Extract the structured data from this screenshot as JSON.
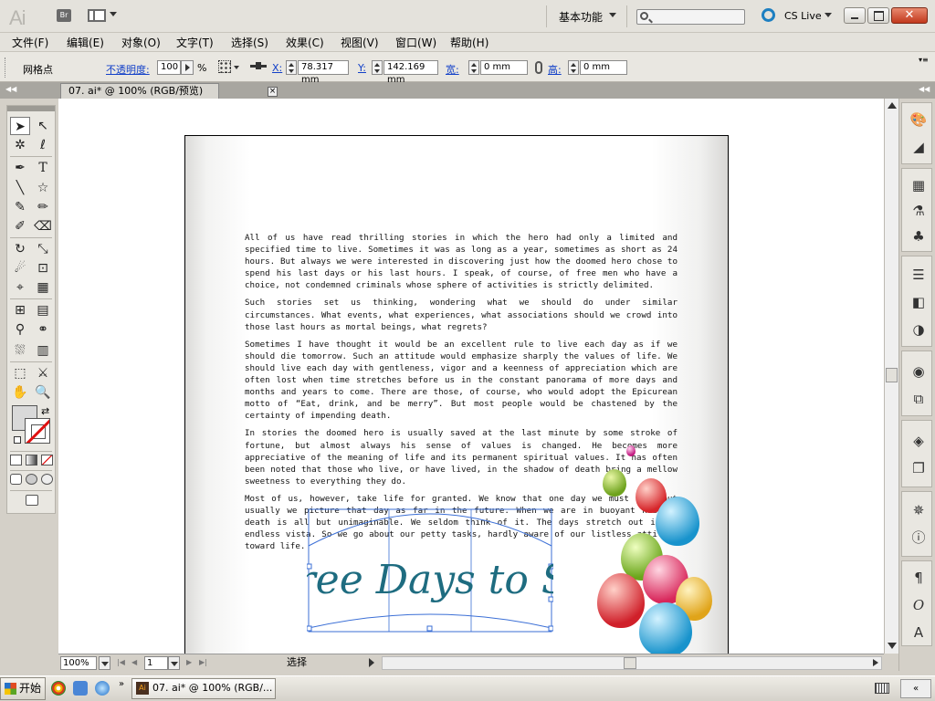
{
  "app": {
    "logo": "Ai",
    "bridge": "Br"
  },
  "titlebar": {
    "workspace": "基本功能",
    "search_placeholder": "",
    "cs_live": "CS Live"
  },
  "menu": [
    "文件(F)",
    "编辑(E)",
    "对象(O)",
    "文字(T)",
    "选择(S)",
    "效果(C)",
    "视图(V)",
    "窗口(W)",
    "帮助(H)"
  ],
  "control": {
    "selection_type": "网格点",
    "opacity_label": "不透明度:",
    "opacity_value": "100",
    "opacity_unit": "%",
    "x_label": "X:",
    "x_value": "78.317 mm",
    "y_label": "Y:",
    "y_value": "142.169 mm",
    "w_label": "宽:",
    "w_value": "0 mm",
    "h_label": "高:",
    "h_value": "0 mm"
  },
  "document": {
    "tab_title": "07. ai* @ 100% (RGB/预览)",
    "close": "×"
  },
  "article": {
    "paragraphs": [
      "All of us have read thrilling stories in which the hero had only a limited and specified time to live. Sometimes it was as long as a year, sometimes as short as 24 hours. But always we were interested in discovering just how the doomed hero chose to spend his last days or his last hours. I speak, of course, of free men who have a choice, not condemned criminals whose sphere of activities is strictly delimited.",
      "Such stories set us thinking, wondering what we should do under similar circumstances. What events, what experiences, what associations should we crowd into those last hours as mortal beings, what regrets?",
      "Sometimes I have thought it would be an excellent rule to live each day as if we should die tomorrow. Such an attitude would emphasize sharply the values of life. We should live each day with gentleness, vigor and a keenness of appreciation which are often lost when time stretches before us in the constant panorama of more days and months and years to come. There are those, of course, who would adopt the Epicurean motto of “Eat, drink, and be merry”. But most people would be chastened by the certainty of impending death.",
      "In stories the doomed hero is usually saved at the last minute by some stroke of fortune, but almost always his sense of values is changed. He becomes more appreciative of the meaning of life and its permanent spiritual values. It has often been noted that those who live, or have lived, in the shadow of death bring a mellow sweetness to everything they do.",
      "Most of us, however, take life for granted. We know that one day we must die, but usually we picture that day as far in the future. When we are in buoyant health, death is all but unimaginable. We seldom think of it. The days stretch out in an endless vista. So we go about our petty tasks, hardly aware of our listless attitude toward life."
    ],
    "title_art": "Three Days to See",
    "title_color": "#1e6c80"
  },
  "statusbar": {
    "zoom": "100%",
    "page": "1",
    "status": "选择"
  },
  "taskbar": {
    "start": "开始",
    "task_title": "07. ai* @ 100% (RGB/...",
    "tray_label": "«"
  },
  "colors": {
    "chrome": "#d4d0c8",
    "link": "#1240c8",
    "close_button": "#c2381c"
  }
}
